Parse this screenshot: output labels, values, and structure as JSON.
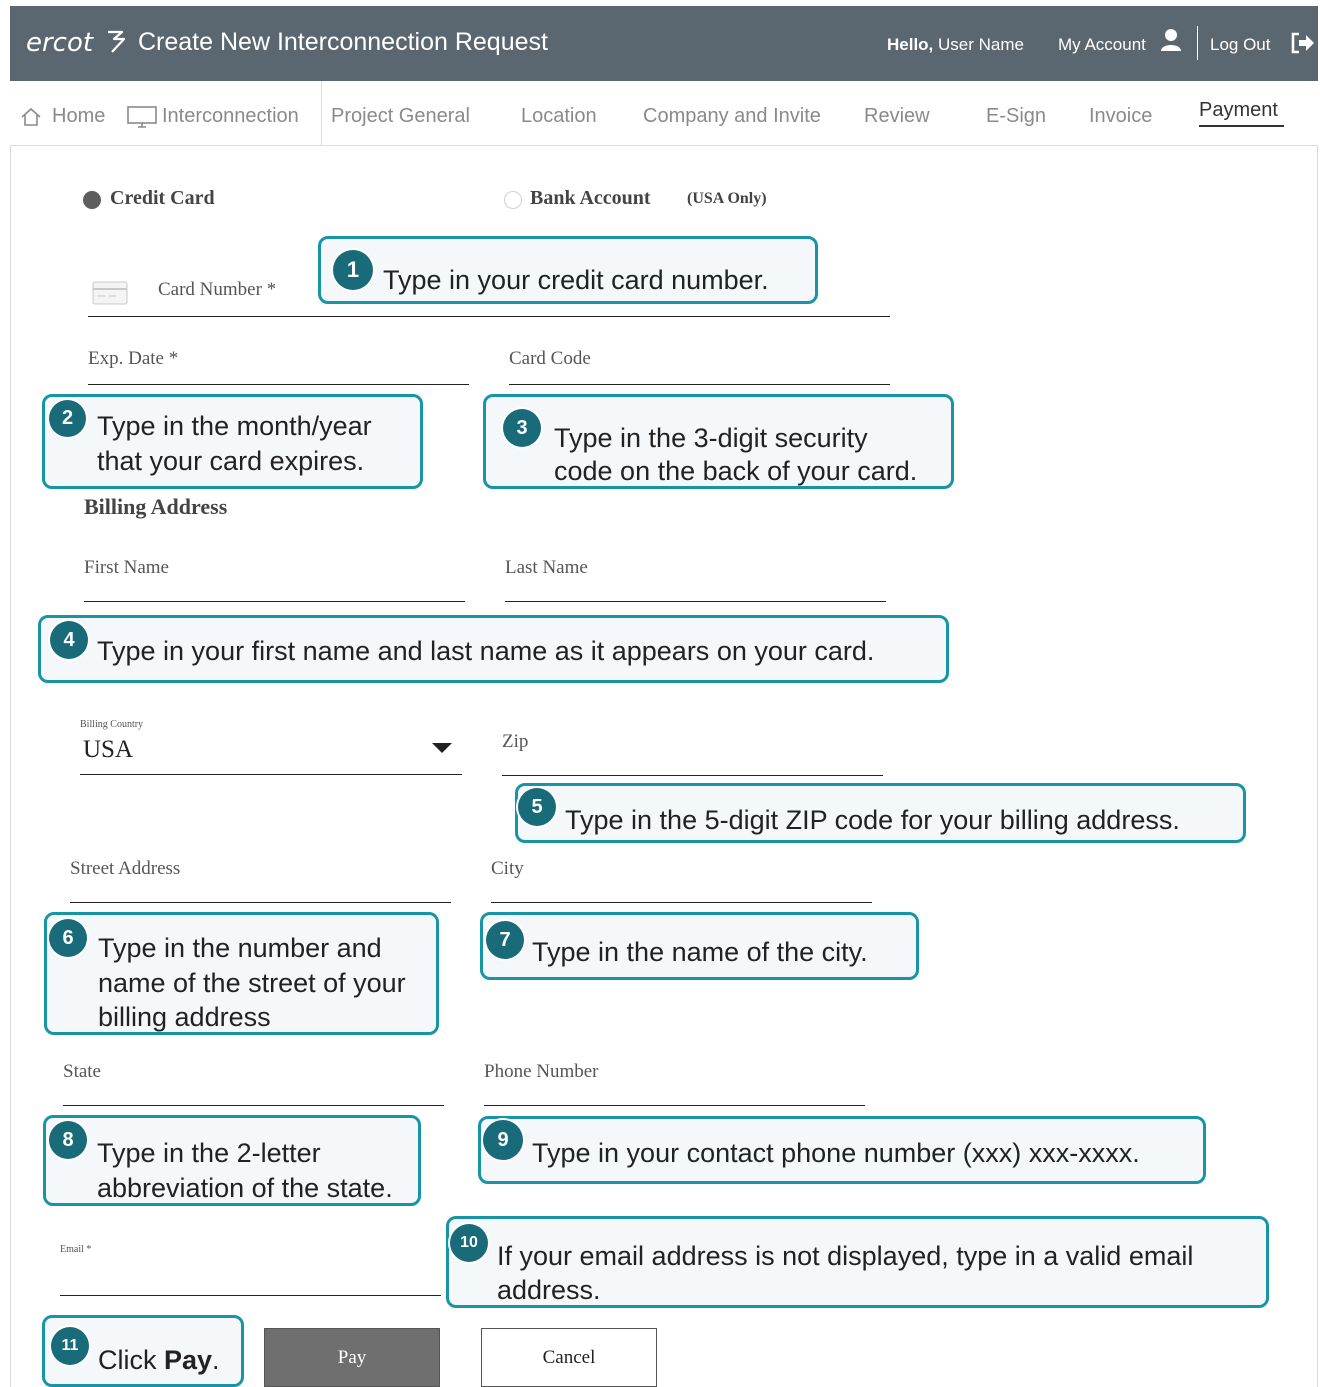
{
  "header": {
    "logo": "ercot",
    "title": "Create New Interconnection Request",
    "hello_prefix": "Hello,",
    "user_name": "User Name",
    "my_account": "My Account",
    "log_out": "Log Out"
  },
  "nav": {
    "home": "Home",
    "interconnection": "Interconnection",
    "steps": [
      "Project General",
      "Location",
      "Company and Invite",
      "Review",
      "E-Sign",
      "Invoice",
      "Payment"
    ],
    "active_step": "Payment"
  },
  "payment_method": {
    "credit_card": "Credit Card",
    "bank_account": "Bank Account",
    "bank_note": "(USA Only)",
    "selected": "Credit Card"
  },
  "form": {
    "card_number": "Card Number",
    "required_mark": "*",
    "exp_date": "Exp. Date",
    "card_code": "Card Code",
    "billing_address": "Billing Address",
    "first_name": "First Name",
    "last_name": "Last Name",
    "billing_country_label": "Billing Country",
    "billing_country_value": "USA",
    "zip": "Zip",
    "street_address": "Street Address",
    "city": "City",
    "state": "State",
    "phone_number": "Phone Number",
    "email": "Email"
  },
  "buttons": {
    "pay": "Pay",
    "cancel": "Cancel"
  },
  "callouts": {
    "c1": {
      "num": "1",
      "text": "Type in your credit card number."
    },
    "c2": {
      "num": "2",
      "line1": "Type in the month/year",
      "line2": "that your card expires."
    },
    "c3": {
      "num": "3",
      "line1": "Type in the 3-digit security",
      "line2": "code on the back of your card."
    },
    "c4": {
      "num": "4",
      "text": "Type in your first name and last name as it appears on your card."
    },
    "c5": {
      "num": "5",
      "text": "Type in the 5-digit ZIP code for your billing address."
    },
    "c6": {
      "num": "6",
      "line1": "Type in the number and",
      "line2": "name of the street of your",
      "line3": "billing address"
    },
    "c7": {
      "num": "7",
      "text": "Type in the name of the city."
    },
    "c8": {
      "num": "8",
      "line1": "Type in the 2-letter",
      "line2": "abbreviation of the state."
    },
    "c9": {
      "num": "9",
      "text": "Type in your contact phone number (xxx) xxx-xxxx."
    },
    "c10": {
      "num": "10",
      "line1": "If your email address is not displayed, type in a valid email",
      "line2": "address."
    },
    "c11": {
      "num": "11",
      "text_prefix": "Click ",
      "text_bold": "Pay",
      "text_suffix": "."
    }
  },
  "colors": {
    "header_bg": "#5b6770",
    "callout_border": "#1795a6",
    "badge_bg": "#1a6b7a",
    "pay_button_bg": "#6f6f6f"
  }
}
